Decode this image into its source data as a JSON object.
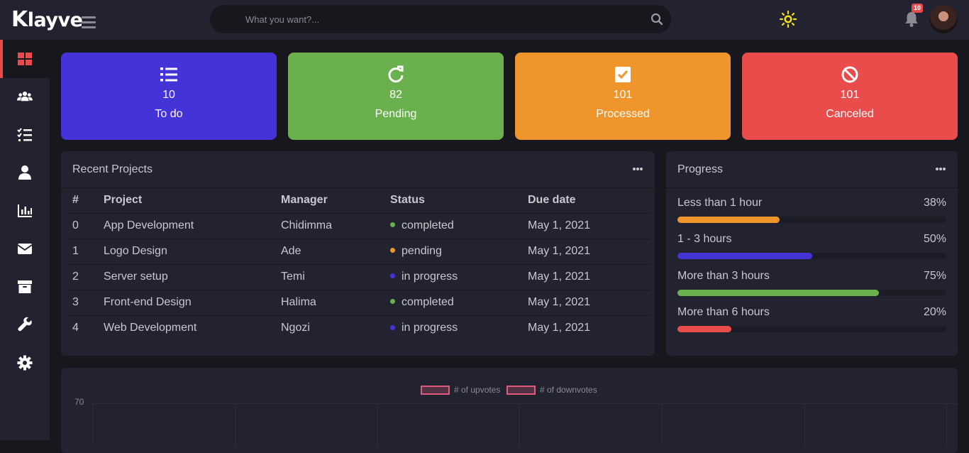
{
  "app": {
    "logo_first": "K",
    "logo_rest": "layve"
  },
  "search": {
    "placeholder": "What you want?..."
  },
  "header": {
    "notification_count": "10"
  },
  "sidebar": {
    "items": [
      {
        "name": "dashboard",
        "icon": "dashboard-icon",
        "active": true
      },
      {
        "name": "users",
        "icon": "users-icon"
      },
      {
        "name": "tasks",
        "icon": "task-list-icon"
      },
      {
        "name": "profile",
        "icon": "user-icon"
      },
      {
        "name": "analytics",
        "icon": "bar-chart-icon"
      },
      {
        "name": "messages",
        "icon": "envelope-icon"
      },
      {
        "name": "archive",
        "icon": "archive-icon"
      },
      {
        "name": "tools",
        "icon": "wrench-icon"
      },
      {
        "name": "settings",
        "icon": "gear-icon"
      }
    ]
  },
  "stats": [
    {
      "value": "10",
      "label": "To do",
      "color": "#4433d6",
      "icon": "list-icon"
    },
    {
      "value": "82",
      "label": "Pending",
      "color": "#6ab04c",
      "icon": "refresh-icon"
    },
    {
      "value": "101",
      "label": "Processed",
      "color": "#ef952c",
      "icon": "checkbox-icon"
    },
    {
      "value": "101",
      "label": "Canceled",
      "color": "#ea4c4c",
      "icon": "ban-icon"
    }
  ],
  "recent_projects": {
    "title": "Recent Projects",
    "columns": [
      "#",
      "Project",
      "Manager",
      "Status",
      "Due date"
    ],
    "rows": [
      {
        "id": "0",
        "project": "App Development",
        "manager": "Chidimma",
        "status": "completed",
        "status_color": "#6ab04c",
        "due": "May 1, 2021"
      },
      {
        "id": "1",
        "project": "Logo Design",
        "manager": "Ade",
        "status": "pending",
        "status_color": "#ef952c",
        "due": "May 1, 2021"
      },
      {
        "id": "2",
        "project": "Server setup",
        "manager": "Temi",
        "status": "in progress",
        "status_color": "#4433d6",
        "due": "May 1, 2021"
      },
      {
        "id": "3",
        "project": "Front-end Design",
        "manager": "Halima",
        "status": "completed",
        "status_color": "#6ab04c",
        "due": "May 1, 2021"
      },
      {
        "id": "4",
        "project": "Web Development",
        "manager": "Ngozi",
        "status": "in progress",
        "status_color": "#4433d6",
        "due": "May 1, 2021"
      }
    ]
  },
  "progress": {
    "title": "Progress",
    "items": [
      {
        "label": "Less than 1 hour",
        "pct": "38%",
        "value": 38,
        "color": "#ef952c"
      },
      {
        "label": "1 - 3 hours",
        "pct": "50%",
        "value": 50,
        "color": "#4433d6"
      },
      {
        "label": "More than 3 hours",
        "pct": "75%",
        "value": 75,
        "color": "#6ab04c"
      },
      {
        "label": "More than 6 hours",
        "pct": "20%",
        "value": 20,
        "color": "#ea4c4c"
      }
    ]
  },
  "chart_data": {
    "type": "bar",
    "title": "",
    "xlabel": "",
    "ylabel": "",
    "ytick_top": "70",
    "series": [
      {
        "name": "# of upvotes",
        "values": []
      },
      {
        "name": "# of downvotes",
        "values": []
      }
    ],
    "categories": []
  }
}
